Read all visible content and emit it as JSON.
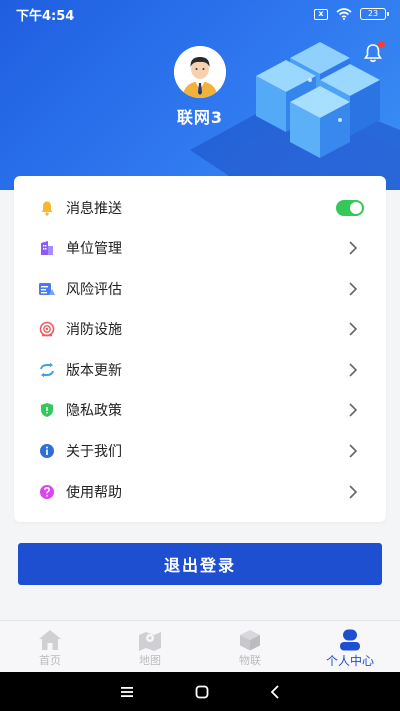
{
  "status_bar": {
    "time": "下午4:54",
    "sim_label": "x",
    "battery": "23"
  },
  "colors": {
    "primary": "#1f4fd1",
    "header": "#2f78ef",
    "toggle_on": "#34c759",
    "notification_dot": "#ff3b30"
  },
  "profile": {
    "username": "联网3",
    "avatar_icon": "businessman-avatar-icon",
    "notification_icon": "bell-icon"
  },
  "menu": {
    "items": [
      {
        "label": "消息推送",
        "icon": "bell-icon",
        "control": "toggle",
        "enabled": true
      },
      {
        "label": "单位管理",
        "icon": "building-icon",
        "control": "chevron"
      },
      {
        "label": "风险评估",
        "icon": "assessment-icon",
        "control": "chevron"
      },
      {
        "label": "消防设施",
        "icon": "fire-hydrant-icon",
        "control": "chevron"
      },
      {
        "label": "版本更新",
        "icon": "refresh-icon",
        "control": "chevron"
      },
      {
        "label": "隐私政策",
        "icon": "shield-icon",
        "control": "chevron"
      },
      {
        "label": "关于我们",
        "icon": "info-icon",
        "control": "chevron"
      },
      {
        "label": "使用帮助",
        "icon": "help-icon",
        "control": "chevron"
      }
    ]
  },
  "logout": {
    "label": "退出登录"
  },
  "tabs": [
    {
      "label": "首页",
      "icon": "home-icon",
      "active": false
    },
    {
      "label": "地图",
      "icon": "map-icon",
      "active": false
    },
    {
      "label": "物联",
      "icon": "cube-icon",
      "active": false
    },
    {
      "label": "个人中心",
      "icon": "person-icon",
      "active": true
    }
  ]
}
